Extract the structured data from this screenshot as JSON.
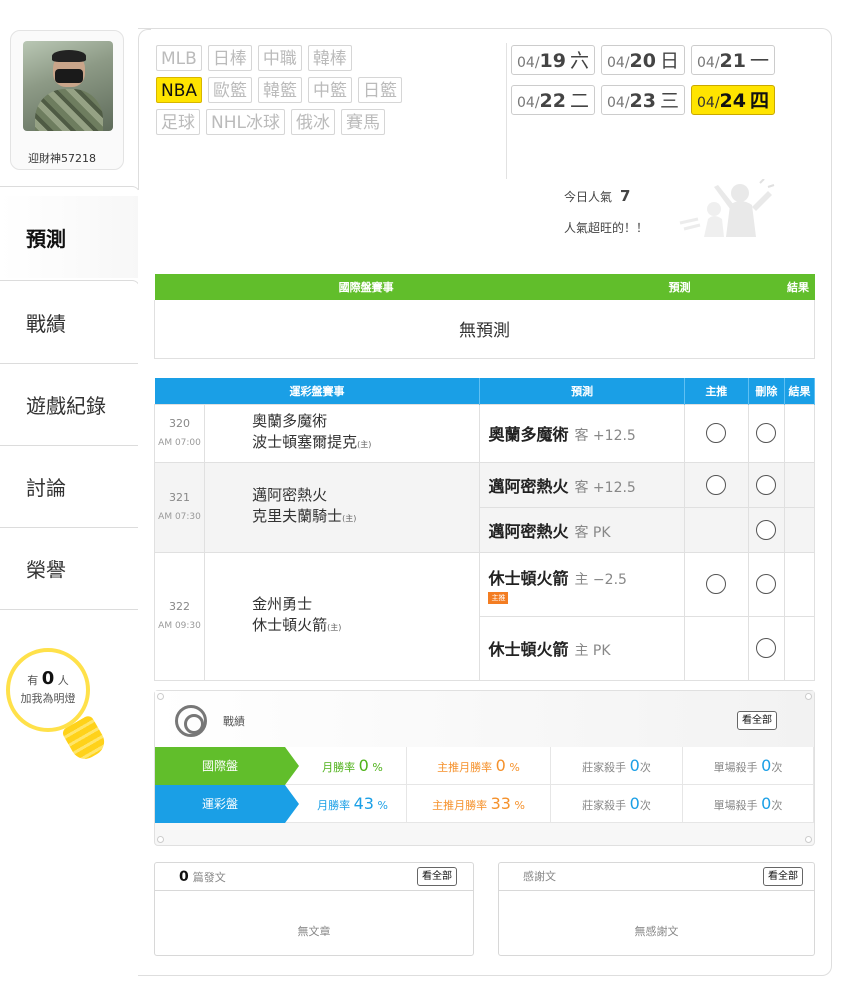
{
  "user": {
    "name": "迎財神57218"
  },
  "nav": [
    "預測",
    "戰績",
    "遊戲紀錄",
    "討論",
    "榮譽"
  ],
  "fans": {
    "prefix": "有",
    "count": "0",
    "suffix": "人",
    "line2": "加我為明燈"
  },
  "leagues": [
    [
      "MLB",
      "日棒",
      "中職",
      "韓棒"
    ],
    [
      "NBA",
      "歐籃",
      "韓籃",
      "中籃",
      "日籃"
    ],
    [
      "足球",
      "NHL冰球",
      "俄冰",
      "賽馬"
    ]
  ],
  "active_league": "NBA",
  "dates": [
    [
      {
        "md": "04/",
        "d": "19",
        "wd": "六"
      },
      {
        "md": "04/",
        "d": "20",
        "wd": "日"
      },
      {
        "md": "04/",
        "d": "21",
        "wd": "一"
      }
    ],
    [
      {
        "md": "04/",
        "d": "22",
        "wd": "二"
      },
      {
        "md": "04/",
        "d": "23",
        "wd": "三"
      },
      {
        "md": "04/",
        "d": "24",
        "wd": "四"
      }
    ]
  ],
  "popularity": {
    "label": "今日人氣",
    "value": "7",
    "note": "人氣超旺的！！"
  },
  "intl_table": {
    "headers": [
      "國際盤賽事",
      "預測",
      "結果"
    ],
    "empty": "無預測"
  },
  "sport_table": {
    "headers": [
      "運彩盤賽事",
      "預測",
      "主推",
      "刪除",
      "結果"
    ],
    "home_mark": "(主)",
    "promo_tag": "主推",
    "games": [
      {
        "no": "320",
        "time": "AM 07:00",
        "away": "奧蘭多魔術",
        "home": "波士頓塞爾提克",
        "picks": [
          {
            "team": "奧蘭多魔術",
            "side": "客 +12.5",
            "has_main": true,
            "is_main": false
          }
        ]
      },
      {
        "no": "321",
        "time": "AM 07:30",
        "away": "邁阿密熱火",
        "home": "克里夫蘭騎士",
        "picks": [
          {
            "team": "邁阿密熱火",
            "side": "客 +12.5",
            "has_main": true,
            "is_main": false
          },
          {
            "team": "邁阿密熱火",
            "side": "客 PK",
            "has_main": false,
            "is_main": false
          }
        ]
      },
      {
        "no": "322",
        "time": "AM 09:30",
        "away": "金州勇士",
        "home": "休士頓火箭",
        "picks": [
          {
            "team": "休士頓火箭",
            "side": "主 −2.5",
            "has_main": true,
            "is_main": true
          },
          {
            "team": "休士頓火箭",
            "side": "主 PK",
            "has_main": false,
            "is_main": false
          }
        ]
      }
    ]
  },
  "record": {
    "title": "戰績",
    "see_all": "看全部",
    "rows": [
      {
        "label": "國際盤",
        "color": "#61be2b",
        "month_rate_label": "月勝率",
        "month_rate": "0",
        "unit": "%",
        "main_rate_label": "主推月勝率",
        "main_rate": "0",
        "banker_label": "莊家殺手",
        "banker": "0",
        "single_label": "單場殺手",
        "single": "0",
        "times": "次"
      },
      {
        "label": "運彩盤",
        "color": "#1a9fe6",
        "month_rate_label": "月勝率",
        "month_rate": "43",
        "unit": "%",
        "main_rate_label": "主推月勝率",
        "main_rate": "33",
        "banker_label": "莊家殺手",
        "banker": "0",
        "single_label": "單場殺手",
        "single": "0",
        "times": "次"
      }
    ]
  },
  "posts": {
    "count": "0",
    "label": "篇發文",
    "see_all": "看全部",
    "empty": "無文章"
  },
  "thanks": {
    "label": "感謝文",
    "see_all": "看全部",
    "empty": "無感謝文"
  }
}
